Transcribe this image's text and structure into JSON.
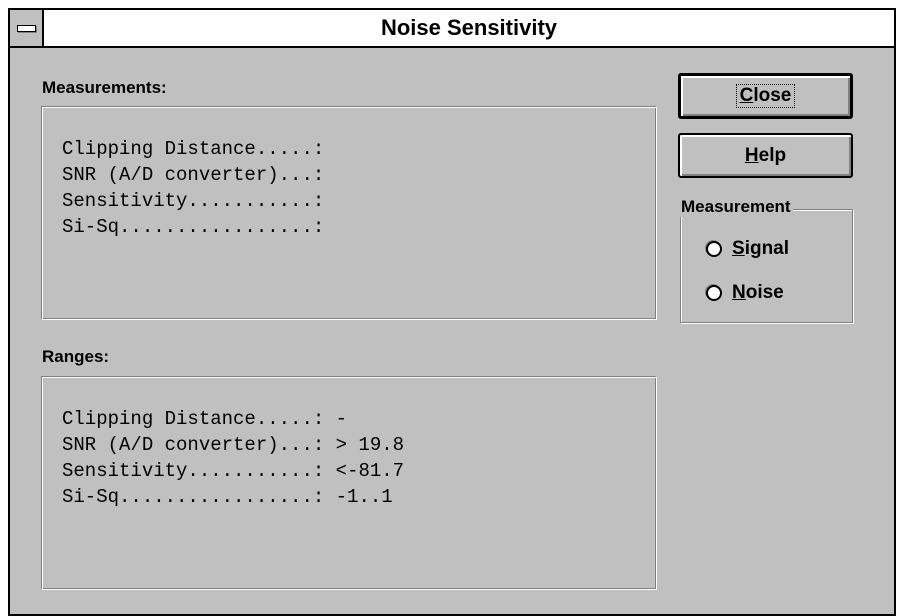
{
  "window": {
    "title": "Noise Sensitivity"
  },
  "measurements": {
    "label": "Measurements:",
    "lines": [
      "Clipping Distance.....:",
      "SNR (A/D converter)...:",
      "Sensitivity...........:",
      "Si-Sq.................:"
    ]
  },
  "ranges": {
    "label": "Ranges:",
    "lines": [
      "Clipping Distance.....: -",
      "SNR (A/D converter)...: > 19.8",
      "Sensitivity...........: <-81.7",
      "Si-Sq.................: -1..1"
    ]
  },
  "buttons": {
    "close": {
      "mnemonic": "C",
      "rest": "lose"
    },
    "help": {
      "mnemonic": "H",
      "rest": "elp"
    }
  },
  "measurement_group": {
    "legend": "Measurement",
    "options": [
      {
        "mnemonic": "S",
        "rest": "ignal",
        "selected": false
      },
      {
        "mnemonic": "N",
        "rest": "oise",
        "selected": false
      }
    ]
  }
}
